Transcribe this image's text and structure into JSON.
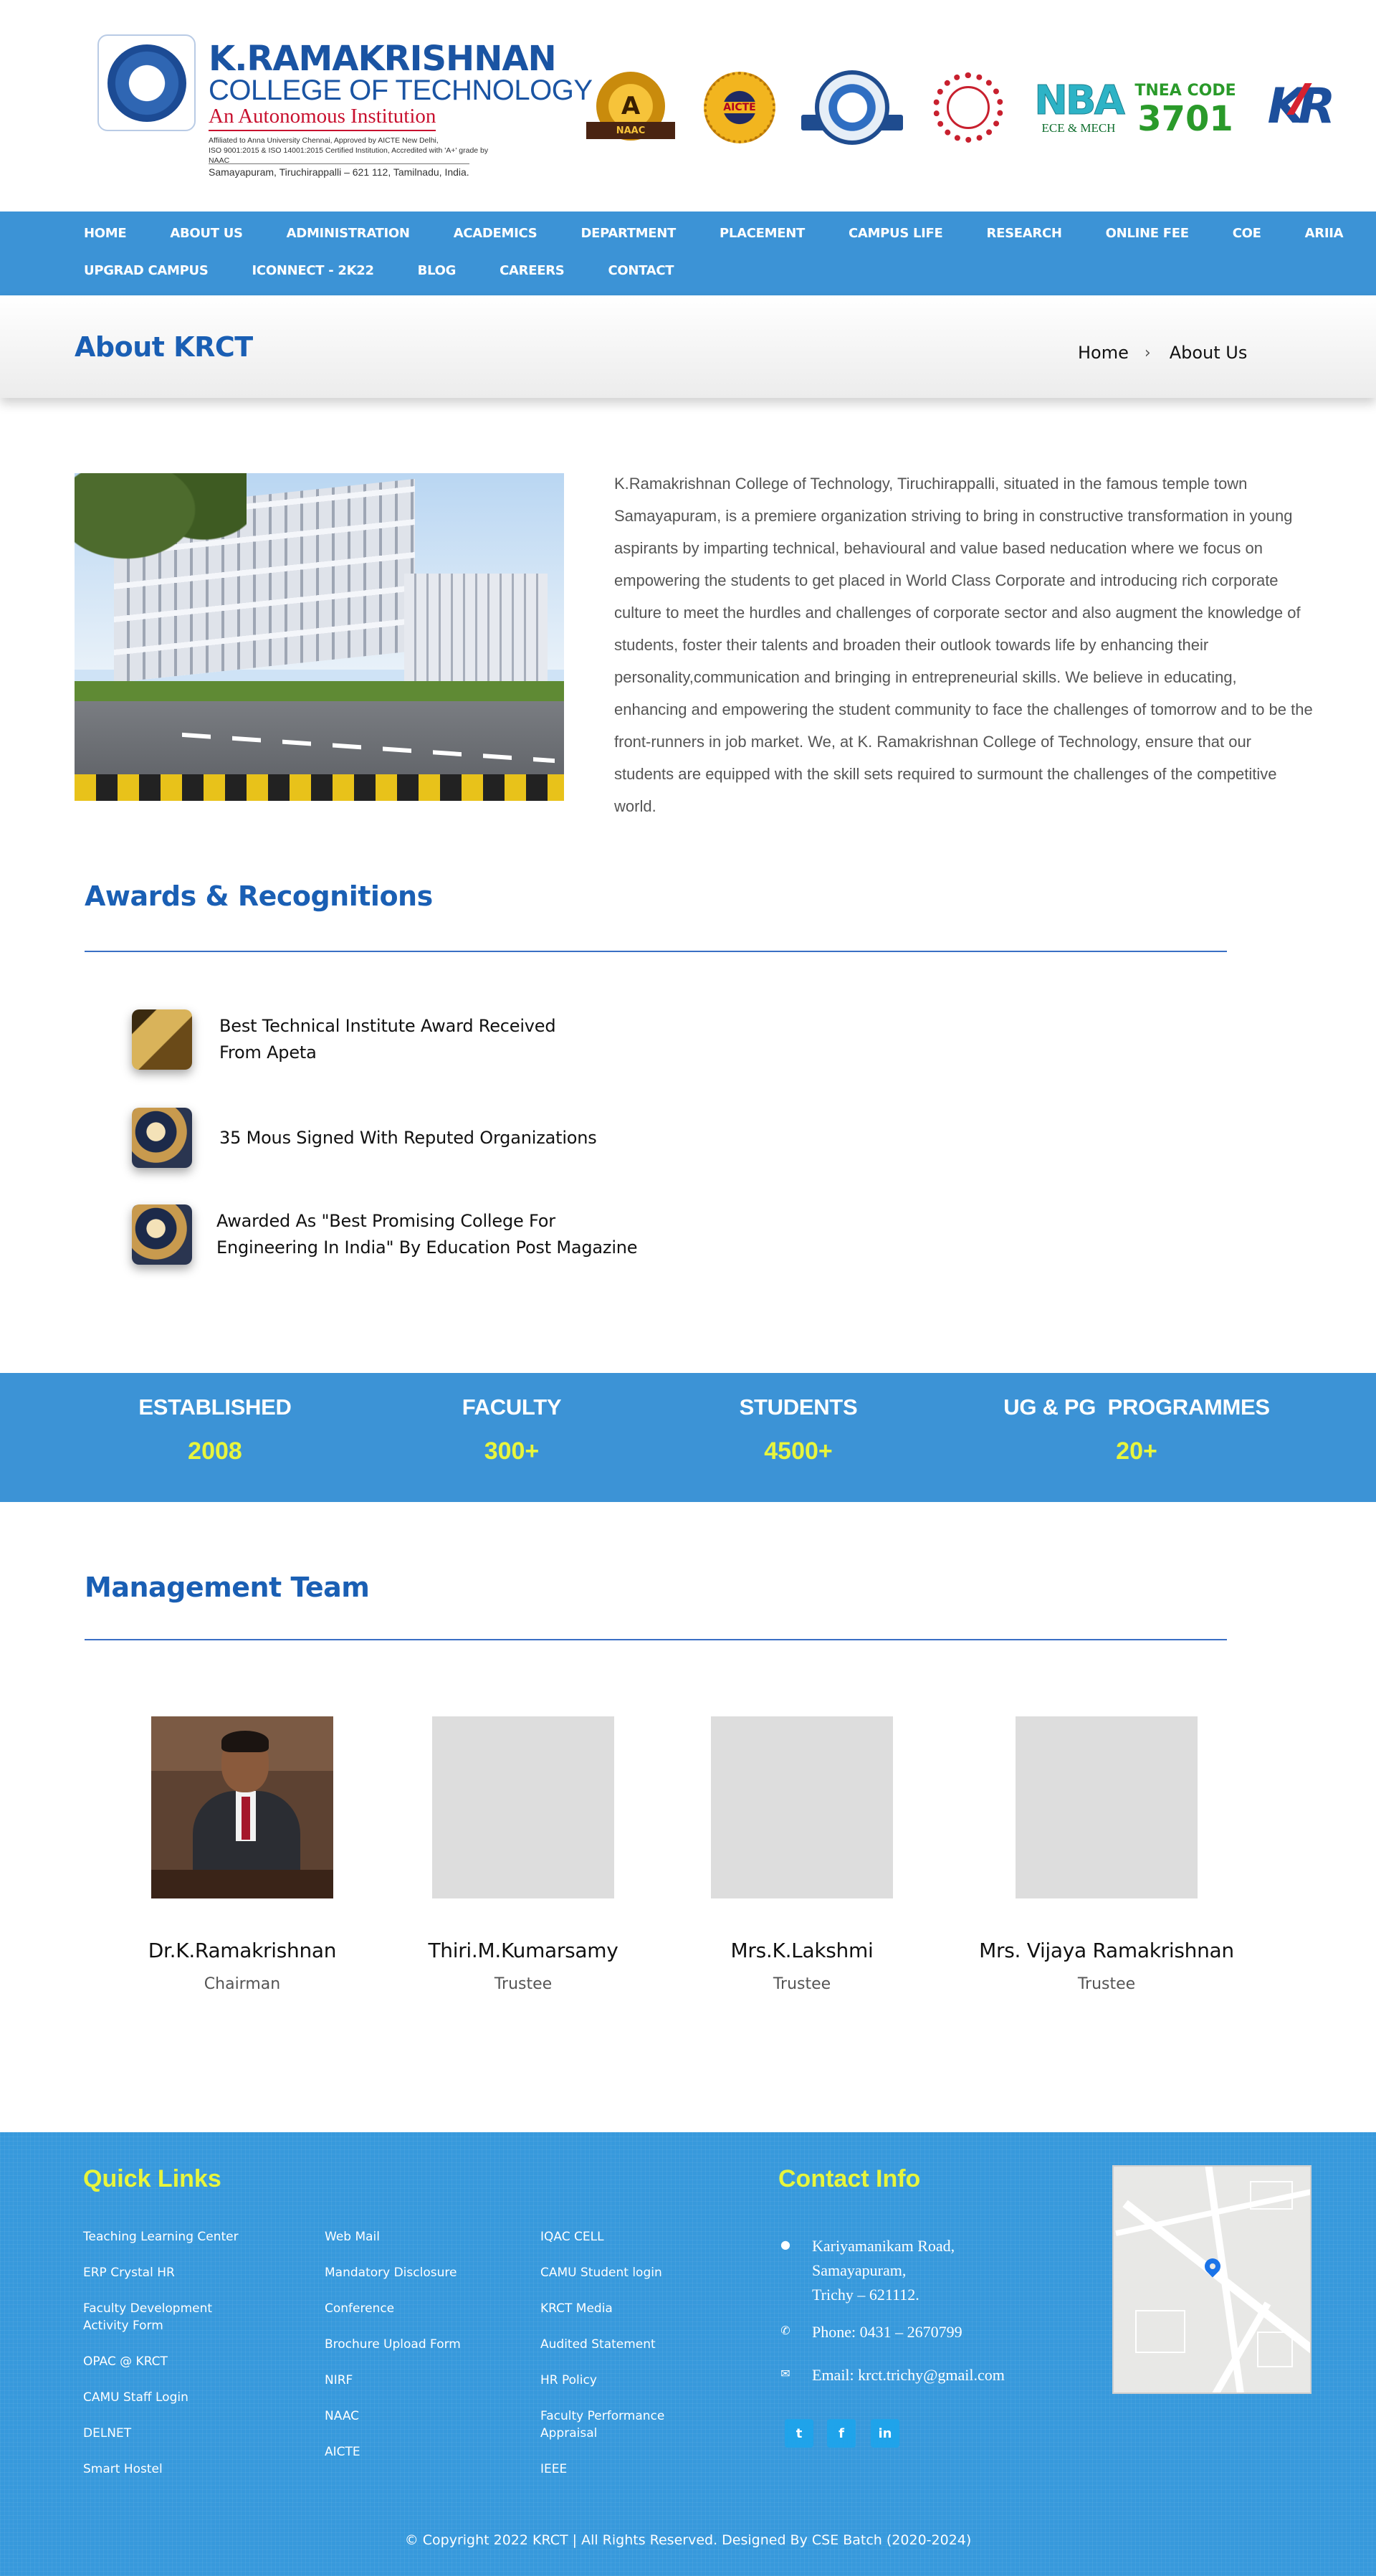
{
  "header": {
    "college_name_line1": "K.RAMAKRISHNAN",
    "college_name_line2": "COLLEGE OF TECHNOLOGY",
    "autonomous": "An Autonomous Institution",
    "affiliation_1": "Affiliated to Anna University Chennai, Approved by AICTE New Delhi,",
    "affiliation_2": "ISO 9001:2015 & ISO 14001:2015 Certified Institution, Accredited with 'A+' grade by NAAC",
    "address": "Samayapuram, Tiruchirappalli – 621 112, Tamilnadu, India.",
    "badges": {
      "naac_letter": "A",
      "naac_ribbon": "NAAC",
      "aicte": "AICTE",
      "nba_word": "NBA",
      "nba_sub": "ECE & MECH",
      "tnea_label": "TNEA CODE",
      "tnea_code": "3701",
      "kr_logo": "KR"
    }
  },
  "nav": {
    "row1": [
      "HOME",
      "ABOUT US",
      "ADMINISTRATION",
      "ACADEMICS",
      "DEPARTMENT",
      "PLACEMENT",
      "CAMPUS LIFE",
      "RESEARCH",
      "ONLINE FEE",
      "COE",
      "ARIIA"
    ],
    "row2": [
      "UPGRAD CAMPUS",
      "ICONNECT - 2K22",
      "BLOG",
      "CAREERS",
      "CONTACT"
    ]
  },
  "title_band": {
    "title": "About KRCT",
    "breadcrumb_home": "Home",
    "breadcrumb_sep": "›",
    "breadcrumb_current": "About Us"
  },
  "about": {
    "text": "K.Ramakrishnan College of Technology, Tiruchirappalli, situated in the famous temple town Samayapuram, is a premiere organization striving to bring  in constructive transformation in young aspirants by imparting technical, behavioural and value based neducation where we focus on empowering  the  students to get placed in World Class Corporate and introducing rich corporate culture to meet the hurdles and challenges of corporate sector and also augment the knowledge of students, foster their talents and broaden their outlook towards life by enhancing their personality,communication and bringing in entrepreneurial skills. We believe in educating, enhancing and empowering the student community to face the challenges of tomorrow and to be the front-runners in job market. We, at K. Ramakrishnan College of Technology, ensure that our students are equipped with the skill sets required to surmount the challenges of the competitive world."
  },
  "awards": {
    "heading": "Awards & Recognitions",
    "items": [
      {
        "line1": "Best Technical Institute Award Received",
        "line2": "From Apeta",
        "icon": "trophy-icon"
      },
      {
        "line1": "35 Mous Signed With Reputed Organizations",
        "line2": "",
        "icon": "mou-icon"
      },
      {
        "line1": "Awarded As \"Best Promising College For",
        "line2": "Engineering In India\" By Education Post Magazine",
        "icon": "award-icon"
      }
    ]
  },
  "stats": [
    {
      "label": "ESTABLISHED",
      "value": "2008"
    },
    {
      "label": "FACULTY",
      "value": "300+"
    },
    {
      "label": "STUDENTS",
      "value": "4500+"
    },
    {
      "label": "UG & PG  PROGRAMMES",
      "value": "20+"
    }
  ],
  "team": {
    "heading": "Management Team",
    "members": [
      {
        "name": "Dr.K.Ramakrishnan",
        "role": "Chairman"
      },
      {
        "name": "Thiri.M.Kumarsamy",
        "role": "Trustee"
      },
      {
        "name": "Mrs.K.Lakshmi",
        "role": "Trustee"
      },
      {
        "name": "Mrs. Vijaya Ramakrishnan",
        "role": "Trustee"
      }
    ]
  },
  "footer": {
    "quick_links_heading": "Quick Links",
    "col1": [
      "Teaching Learning Center",
      "ERP Crystal HR",
      "Faculty Development\nActivity Form",
      "OPAC @ KRCT",
      "CAMU Staff Login",
      "DELNET",
      "Smart Hostel"
    ],
    "col2": [
      "Web Mail",
      "Mandatory Disclosure",
      "Conference",
      "Brochure Upload Form",
      "NIRF",
      "NAAC",
      "AICTE"
    ],
    "col3": [
      "IQAC CELL",
      "CAMU Student login",
      "KRCT Media",
      "Audited Statement",
      "HR Policy",
      "Faculty Performance\nAppraisal",
      "IEEE"
    ],
    "contact_heading": "Contact Info",
    "address": "Kariyamanikam Road,\nSamayapuram,\nTrichy – 621112.",
    "phone": "Phone: 0431 – 2670799",
    "email": "Email: krct.trichy@gmail.com",
    "social": {
      "twitter": "t",
      "facebook": "f",
      "linkedin": "in"
    },
    "copyright": "©  Copyright 2022 KRCT | All Rights Reserved. Designed By CSE Batch (2020-2024)"
  },
  "colors": {
    "nav_blue": "#3c93d6",
    "heading_blue": "#1a5fb4",
    "stat_yellow": "#e8f53c",
    "footer_blue": "#3799dc"
  }
}
